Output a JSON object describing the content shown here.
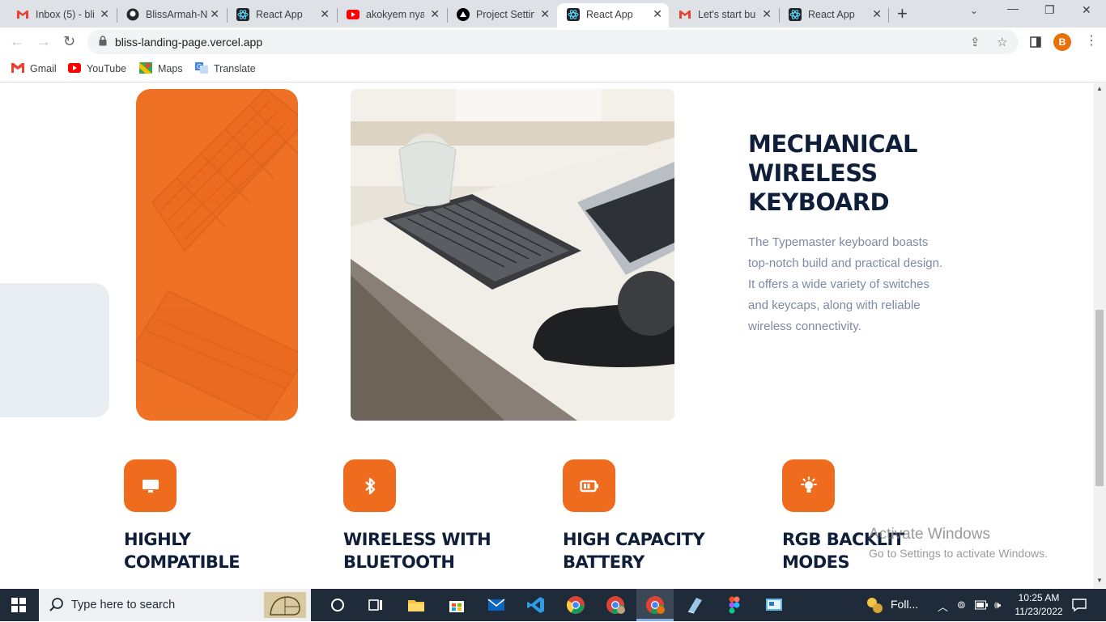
{
  "browser": {
    "tabs": [
      {
        "title": "Inbox (5) - bli",
        "icon": "gmail-icon",
        "active": false
      },
      {
        "title": "BlissArmah-N",
        "icon": "github-icon",
        "active": false
      },
      {
        "title": "React App",
        "icon": "react-icon",
        "active": false
      },
      {
        "title": "akokyem nyar",
        "icon": "youtube-icon",
        "active": false
      },
      {
        "title": "Project Settin",
        "icon": "vercel-icon",
        "active": false
      },
      {
        "title": "React App",
        "icon": "react-icon",
        "active": true
      },
      {
        "title": "Let's start bui",
        "icon": "gmail-icon",
        "active": false
      },
      {
        "title": "React App",
        "icon": "react-icon",
        "active": false
      }
    ],
    "url": "bliss-landing-page.vercel.app",
    "profile_initial": "B",
    "bookmarks": [
      {
        "label": "Gmail",
        "icon": "gmail-icon"
      },
      {
        "label": "YouTube",
        "icon": "youtube-icon"
      },
      {
        "label": "Maps",
        "icon": "maps-icon"
      },
      {
        "label": "Translate",
        "icon": "translate-icon"
      }
    ]
  },
  "product": {
    "title_lines": [
      "MECHANICAL",
      "WIRELESS",
      "KEYBOARD"
    ],
    "description": "The Typemaster keyboard boasts top-notch build and practical design. It offers a wide variety of switches and keycaps, along with reliable wireless connectivity."
  },
  "features": [
    {
      "icon": "monitor-icon",
      "title_lines": [
        "HIGHLY",
        "COMPATIBLE"
      ]
    },
    {
      "icon": "bluetooth-icon",
      "title_lines": [
        "WIRELESS WITH",
        "BLUETOOTH"
      ]
    },
    {
      "icon": "battery-icon",
      "title_lines": [
        "HIGH CAPACITY",
        "BATTERY"
      ]
    },
    {
      "icon": "lightbulb-icon",
      "title_lines": [
        "RGB BACKLIT",
        "MODES"
      ]
    }
  ],
  "watermark": {
    "line1": "Activate Windows",
    "line2": "Go to Settings to activate Windows."
  },
  "taskbar": {
    "search_placeholder": "Type here to search",
    "tray_label": "Foll...",
    "time": "10:25 AM",
    "date": "11/23/2022"
  },
  "colors": {
    "accent": "#ef6c1f",
    "heading": "#0f1f3a",
    "body_text": "#7d8aa3"
  }
}
